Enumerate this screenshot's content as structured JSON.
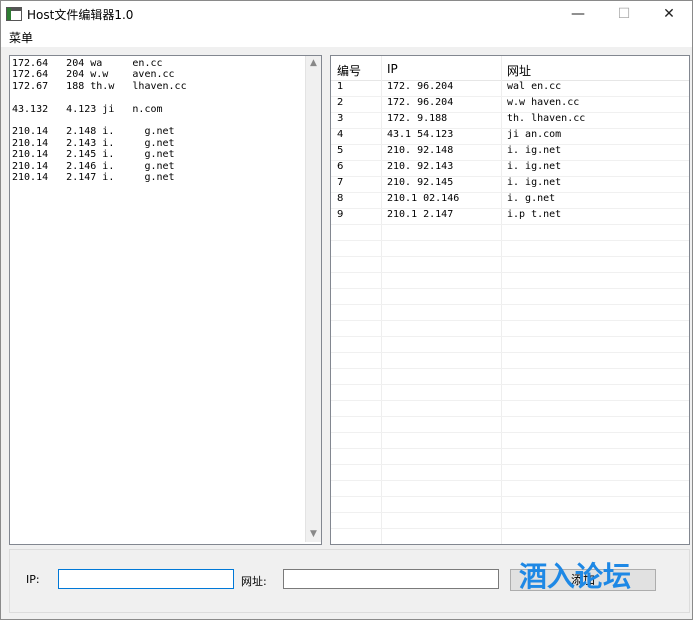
{
  "window": {
    "title": "Host文件编辑器1.0",
    "controls": {
      "minimize": "—",
      "maximize": "☐",
      "close": "✕"
    }
  },
  "menu": {
    "items": [
      "菜单"
    ]
  },
  "editor": {
    "lines": [
      "172.64   204 wa     en.cc",
      "172.64   204 w.w    aven.cc",
      "172.67   188 th.w   lhaven.cc",
      "",
      "43.132   4.123 ji   n.com",
      "",
      "210.14   2.148 i.     g.net",
      "210.14   2.143 i.     g.net",
      "210.14   2.145 i.     g.net",
      "210.14   2.146 i.     g.net",
      "210.14   2.147 i.     g.net"
    ]
  },
  "table": {
    "columns": [
      "编号",
      "IP",
      "网址"
    ],
    "rows": [
      {
        "id": "1",
        "ip": "172.    96.204",
        "url": "wal    en.cc"
      },
      {
        "id": "2",
        "ip": "172.    96.204",
        "url": "w.w    haven.cc"
      },
      {
        "id": "3",
        "ip": "172.    9.188",
        "url": "th.    lhaven.cc"
      },
      {
        "id": "4",
        "ip": "43.1    54.123",
        "url": "ji    an.com"
      },
      {
        "id": "5",
        "ip": "210.    92.148",
        "url": "i.    ig.net"
      },
      {
        "id": "6",
        "ip": "210.    92.143",
        "url": "i.    ig.net"
      },
      {
        "id": "7",
        "ip": "210.    92.145",
        "url": "i.    ig.net"
      },
      {
        "id": "8",
        "ip": "210.1    02.146",
        "url": "i.    g.net"
      },
      {
        "id": "9",
        "ip": "210.1    2.147",
        "url": "i.p    t.net"
      }
    ]
  },
  "form": {
    "ip_label": "IP:",
    "url_label": "网址:",
    "ip_value": "",
    "url_value": "",
    "add_button": "添加"
  },
  "watermark": {
    "text": "酒入论坛"
  }
}
